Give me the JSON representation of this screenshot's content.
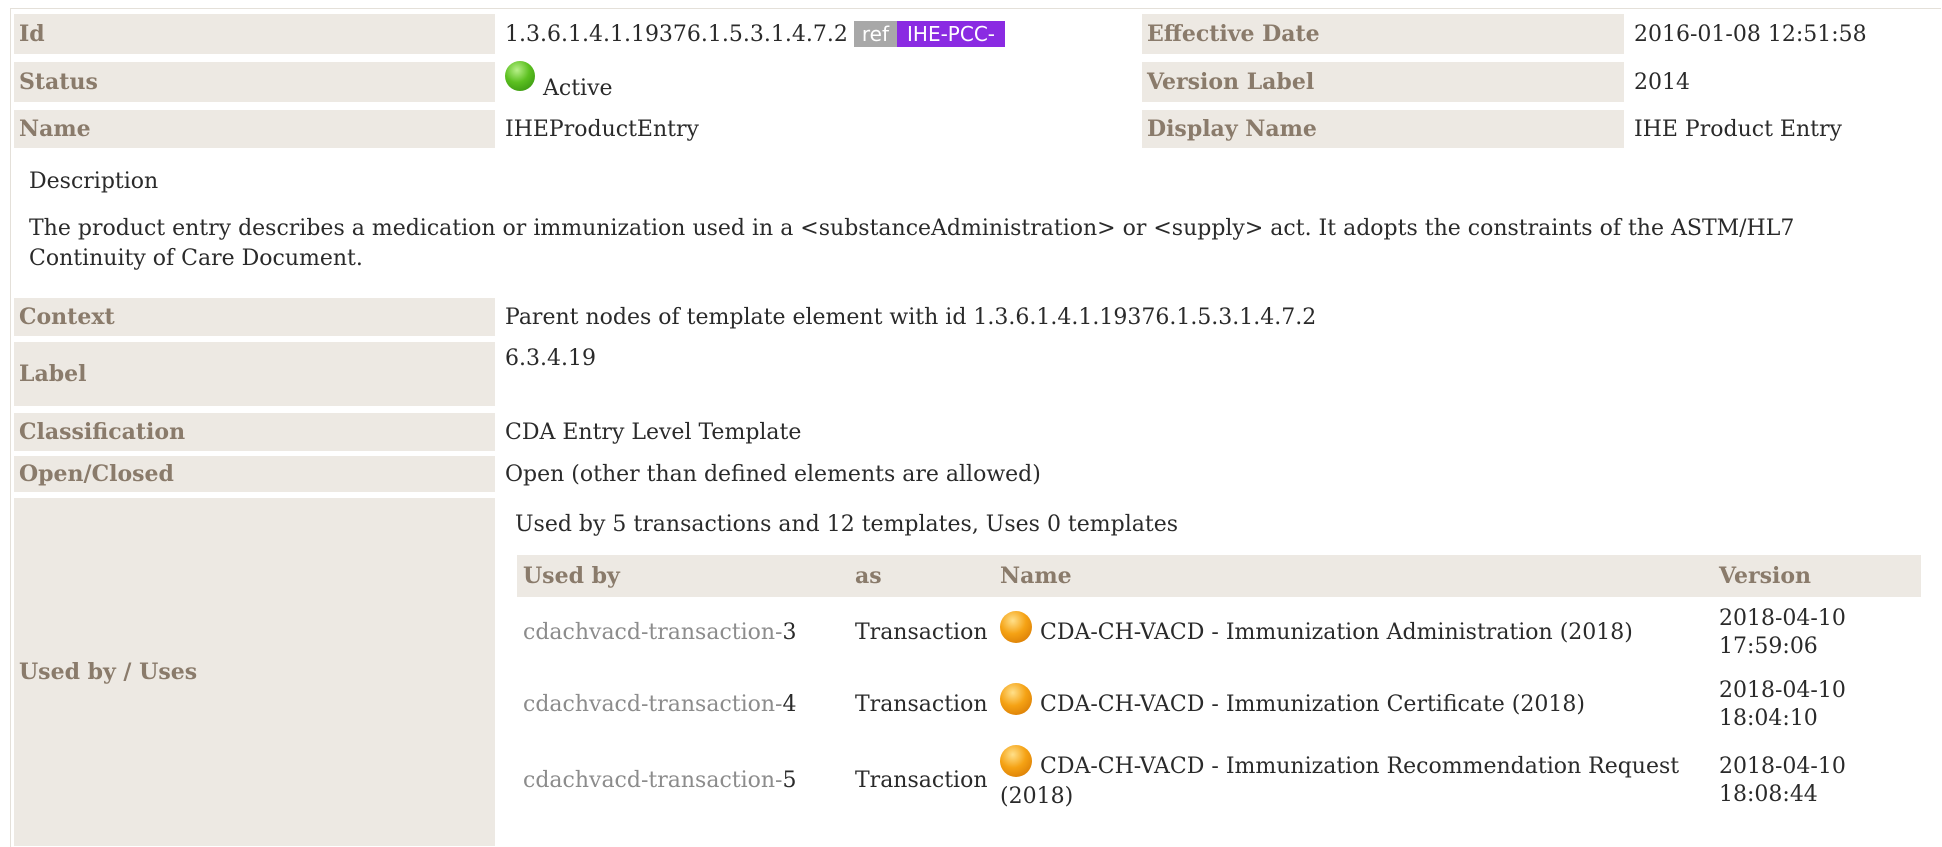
{
  "summary_rows": {
    "id": {
      "label": "Id",
      "value": "1.3.6.1.4.1.19376.1.5.3.1.4.7.2",
      "ref_tag": "ref",
      "prefix_tag": "IHE-PCC-"
    },
    "effective_date": {
      "label": "Effective Date",
      "value": "2016-01-08 12:51:58"
    },
    "status": {
      "label": "Status",
      "value": "Active",
      "status_color": "#5cc020"
    },
    "version_label": {
      "label": "Version Label",
      "value": "2014"
    },
    "name": {
      "label": "Name",
      "value": "IHEProductEntry"
    },
    "display_name": {
      "label": "Display Name",
      "value": "IHE Product Entry"
    }
  },
  "description": {
    "heading": "Description",
    "text": "The product entry describes a medication or immunization used in a <substanceAdministration> or <supply> act. It adopts the constraints of the ASTM/HL7 Continuity of Care Document."
  },
  "details": {
    "context": {
      "label": "Context",
      "value": "Parent nodes of template element with id 1.3.6.1.4.1.19376.1.5.3.1.4.7.2"
    },
    "label": {
      "label": "Label",
      "value": "6.3.4.19"
    },
    "classification": {
      "label": "Classification",
      "value": "CDA Entry Level Template"
    },
    "open_closed": {
      "label": "Open/Closed",
      "value": "Open (other than defined elements are allowed)"
    }
  },
  "used_by": {
    "label": "Used by / Uses",
    "summary": "Used by 5 transactions and 12 templates, Uses 0 templates",
    "columns": [
      "Used by",
      "as",
      "Name",
      "Version"
    ],
    "rows": [
      {
        "ref_prefix": "cdachvacd-transaction-",
        "ref_num": "3",
        "as": "Transaction",
        "name": "CDA-CH-VACD - Immunization Administration (2018)",
        "version_date": "2018-04-10",
        "version_time": "17:59:06",
        "status_color": "#f5a214"
      },
      {
        "ref_prefix": "cdachvacd-transaction-",
        "ref_num": "4",
        "as": "Transaction",
        "name": "CDA-CH-VACD - Immunization Certificate (2018)",
        "version_date": "2018-04-10",
        "version_time": "18:04:10",
        "status_color": "#f5a214"
      },
      {
        "ref_prefix": "cdachvacd-transaction-",
        "ref_num": "5",
        "as": "Transaction",
        "name": "CDA-CH-VACD - Immunization Recommendation Request (2018)",
        "version_date": "2018-04-10",
        "version_time": "18:08:44",
        "status_color": "#f5a214"
      }
    ]
  }
}
